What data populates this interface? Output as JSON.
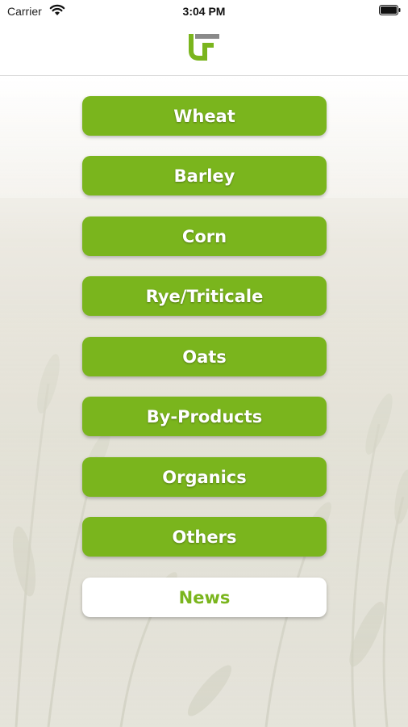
{
  "status_bar": {
    "carrier": "Carrier",
    "time": "3:04 PM",
    "icons": [
      "wifi-icon",
      "battery-icon"
    ]
  },
  "header": {
    "logo": "app-logo-icon"
  },
  "menu": {
    "items": [
      {
        "label": "Wheat"
      },
      {
        "label": "Barley"
      },
      {
        "label": "Corn"
      },
      {
        "label": "Rye/Triticale"
      },
      {
        "label": "Oats"
      },
      {
        "label": "By-Products"
      },
      {
        "label": "Organics"
      },
      {
        "label": "Others"
      },
      {
        "label": "News"
      }
    ]
  },
  "colors": {
    "accent": "#7ab51d",
    "button_text": "#ffffff",
    "news_button_bg": "#ffffff",
    "logo_gray": "#8a8a8a"
  }
}
